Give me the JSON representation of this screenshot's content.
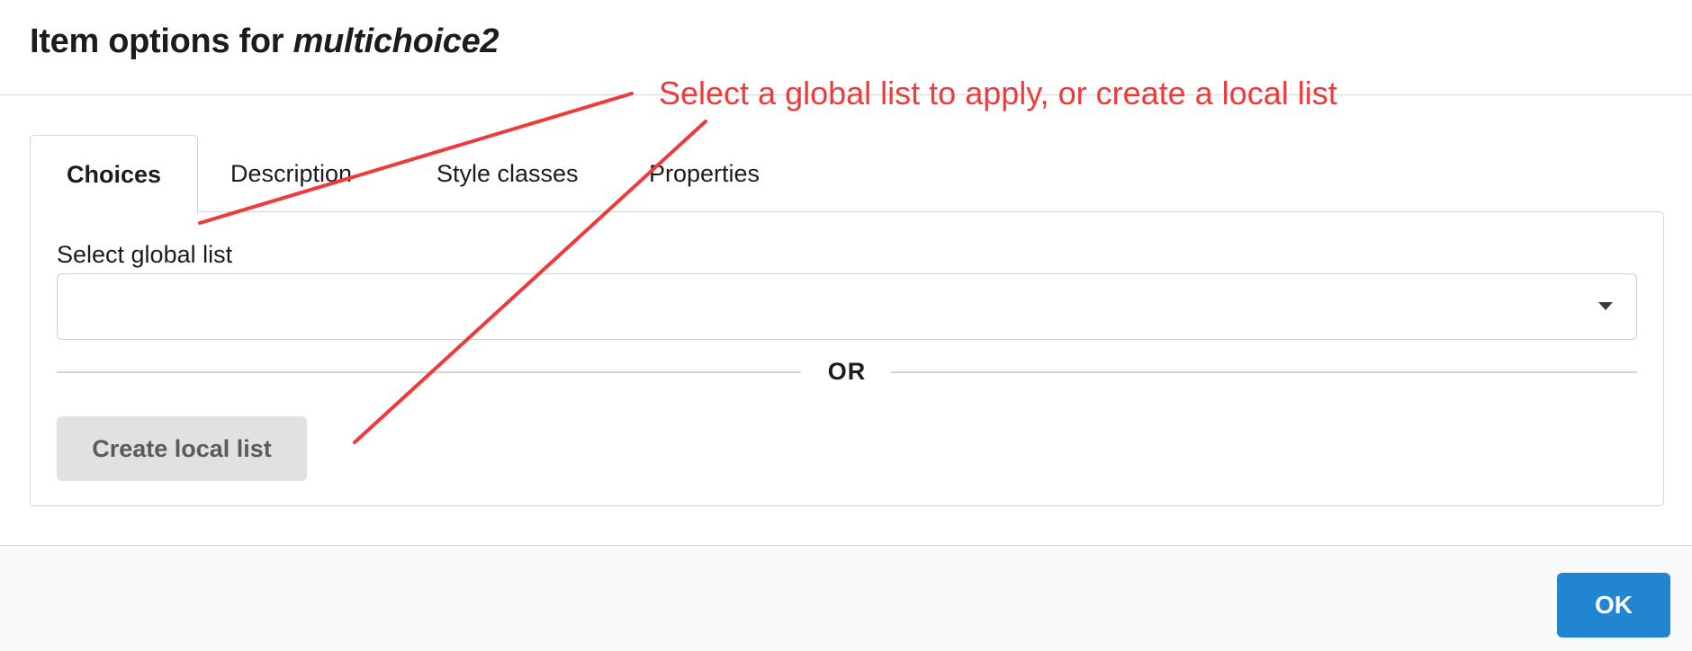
{
  "dialog": {
    "title_prefix": "Item options for",
    "title_item": "multichoice2"
  },
  "tabs": [
    {
      "label": "Choices",
      "active": true
    },
    {
      "label": "Description",
      "active": false
    },
    {
      "label": "Style classes",
      "active": false
    },
    {
      "label": "Properties",
      "active": false
    }
  ],
  "choices_panel": {
    "global_list_label": "Select global list",
    "global_list_value": "",
    "divider_text": "OR",
    "create_local_list_label": "Create local list"
  },
  "footer": {
    "ok_label": "OK"
  },
  "annotation": {
    "text": "Select a global list to apply, or create a local list",
    "color": "#f03a3a"
  },
  "colors": {
    "primary_button": "#2185d0",
    "secondary_button": "#e0e1e2",
    "annotation_red": "#f03a3a"
  }
}
